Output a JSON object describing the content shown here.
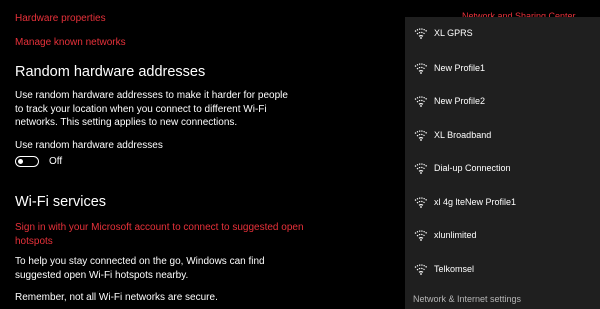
{
  "settings": {
    "hardware_properties": "Hardware properties",
    "manage_known_networks": "Manage known networks",
    "random_hw_heading": "Random hardware addresses",
    "random_hw_description": "Use random hardware addresses to make it harder for people to track your location when you connect to different Wi-Fi networks. This setting applies to new connections.",
    "random_hw_toggle_label": "Use random hardware addresses",
    "random_hw_toggle_state": "Off",
    "wifi_services_heading": "Wi-Fi services",
    "wifi_services_signin": "Sign in with your Microsoft account to connect to suggested open hotspots",
    "wifi_services_description": "To help you stay connected on the go, Windows can find suggested open Wi-Fi hotspots nearby.",
    "wifi_services_warning": "Remember, not all Wi-Fi networks are secure.",
    "network_sharing_center": "Network and Sharing Center"
  },
  "flyout": {
    "networks": [
      {
        "name": "XL GPRS",
        "icon": "wifi-icon"
      },
      {
        "name": "New Profile1",
        "icon": "wifi-icon"
      },
      {
        "name": "New Profile2",
        "icon": "wifi-icon"
      },
      {
        "name": "XL Broadband",
        "icon": "wifi-icon"
      },
      {
        "name": "Dial-up Connection",
        "icon": "wifi-icon"
      },
      {
        "name": "xl 4g lteNew Profile1",
        "icon": "wifi-icon"
      },
      {
        "name": "xlunlimited",
        "icon": "wifi-icon"
      },
      {
        "name": "Telkomsel",
        "icon": "wifi-icon"
      }
    ],
    "footer": "Network & Internet settings"
  },
  "colors": {
    "accent": "#e8313a",
    "background": "#000000",
    "flyout_background": "#1f1f1f"
  }
}
